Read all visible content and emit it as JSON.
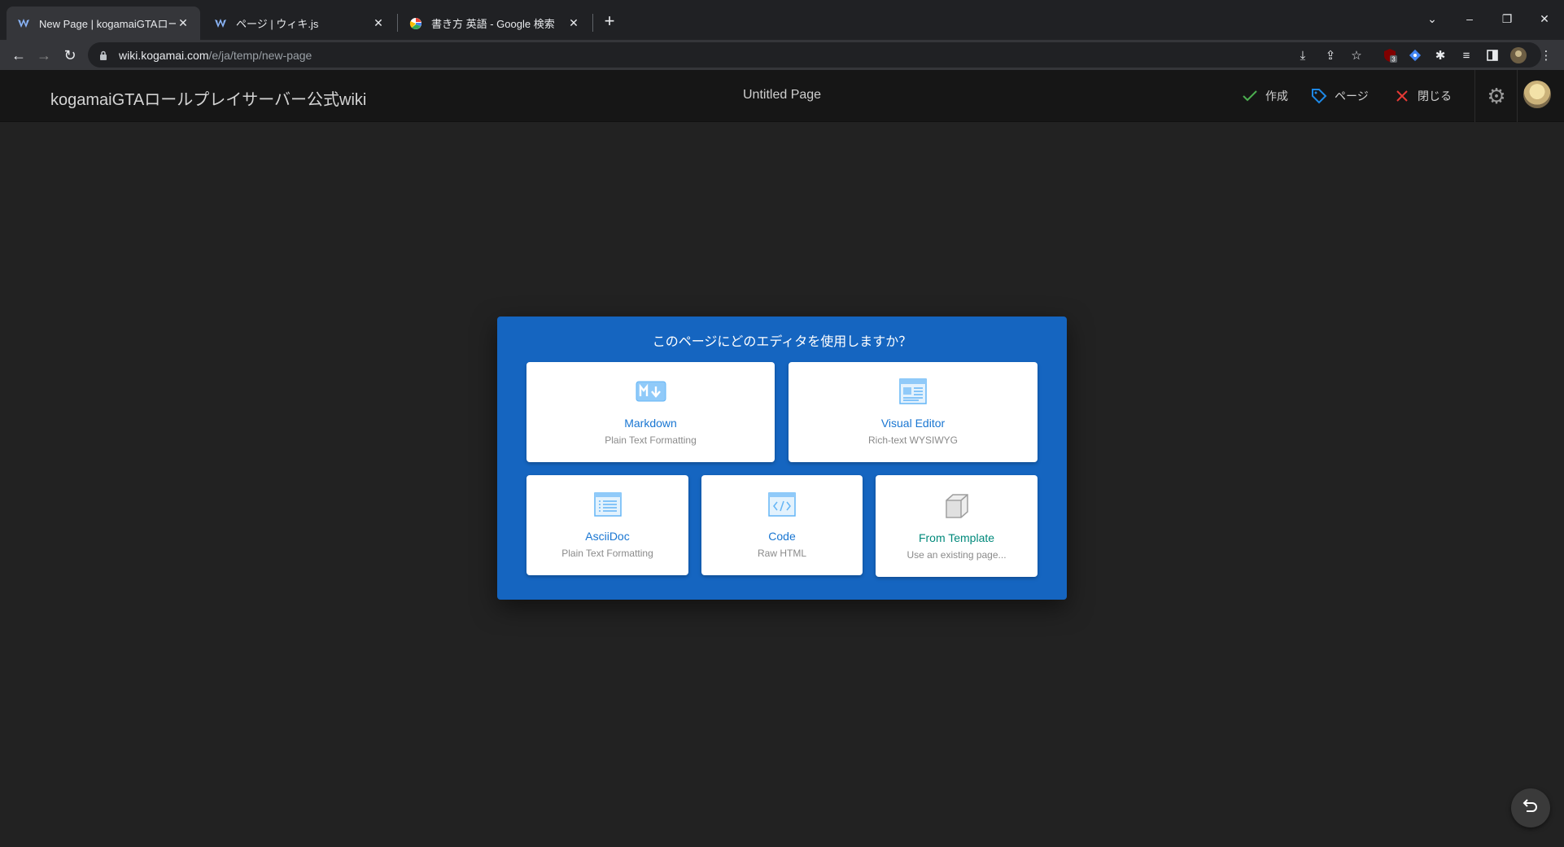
{
  "browser": {
    "tabs": [
      {
        "title": "New Page | kogamaiGTAロールプレ",
        "favicon": "wikijs-icon",
        "active": true
      },
      {
        "title": "ページ | ウィキ.js",
        "favicon": "wikijs-icon",
        "active": false
      },
      {
        "title": "書き方 英語 - Google 検索",
        "favicon": "google-icon",
        "active": false
      }
    ],
    "url_host": "wiki.kogamai.com",
    "url_path": "/e/ja/temp/new-page",
    "extension_badge": "3"
  },
  "appbar": {
    "site_title": "kogamaiGTAロールプレイサーバー公式wiki",
    "page_title": "Untitled Page",
    "create_label": "作成",
    "page_label": "ページ",
    "close_label": "閉じる"
  },
  "dialog": {
    "title": "このページにどのエディタを使用しますか？",
    "editors": [
      {
        "name": "Markdown",
        "sub": "Plain Text Formatting",
        "icon": "markdown-icon"
      },
      {
        "name": "Visual Editor",
        "sub": "Rich-text WYSIWYG",
        "icon": "visual-editor-icon"
      },
      {
        "name": "AsciiDoc",
        "sub": "Plain Text Formatting",
        "icon": "asciidoc-icon"
      },
      {
        "name": "Code",
        "sub": "Raw HTML",
        "icon": "code-icon"
      },
      {
        "name": "From Template",
        "sub": "Use an existing page...",
        "icon": "template-icon"
      }
    ]
  },
  "colors": {
    "dialog_bg": "#1565c0",
    "appbar_bg": "#161616",
    "page_bg": "#222222",
    "create_check": "#4caf50",
    "page_tag": "#1e88e5",
    "close_x": "#e53935",
    "template_name": "#00897b"
  }
}
